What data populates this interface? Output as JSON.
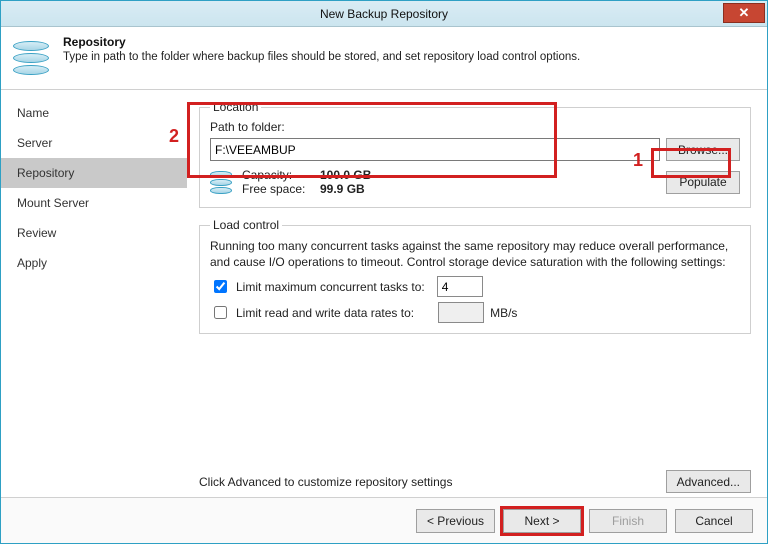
{
  "window": {
    "title": "New Backup Repository"
  },
  "header": {
    "title": "Repository",
    "subtitle": "Type in path to the folder where backup files should be stored, and set repository load control options."
  },
  "sidebar": {
    "items": [
      {
        "label": "Name"
      },
      {
        "label": "Server"
      },
      {
        "label": "Repository"
      },
      {
        "label": "Mount Server"
      },
      {
        "label": "Review"
      },
      {
        "label": "Apply"
      }
    ],
    "activeIndex": 2
  },
  "location": {
    "legend": "Location",
    "pathLabel": "Path to folder:",
    "pathValue": "F:\\VEEAMBUP",
    "browse": "Browse...",
    "populate": "Populate",
    "capacityLabel": "Capacity:",
    "capacityValue": "100.0 GB",
    "freeLabel": "Free space:",
    "freeValue": "99.9 GB"
  },
  "load": {
    "legend": "Load control",
    "desc": "Running too many concurrent tasks against the same repository may reduce overall performance, and cause I/O operations to timeout. Control storage device saturation with the following settings:",
    "limitTasksLabel": "Limit maximum concurrent tasks to:",
    "limitTasksValue": "4",
    "limitRatesLabel": "Limit read and write data rates to:",
    "limitRatesUnit": "MB/s"
  },
  "advanced": {
    "hint": "Click Advanced to customize repository settings",
    "button": "Advanced..."
  },
  "footer": {
    "previous": "< Previous",
    "next": "Next >",
    "finish": "Finish",
    "cancel": "Cancel"
  },
  "annotations": {
    "one": "1",
    "two": "2"
  }
}
